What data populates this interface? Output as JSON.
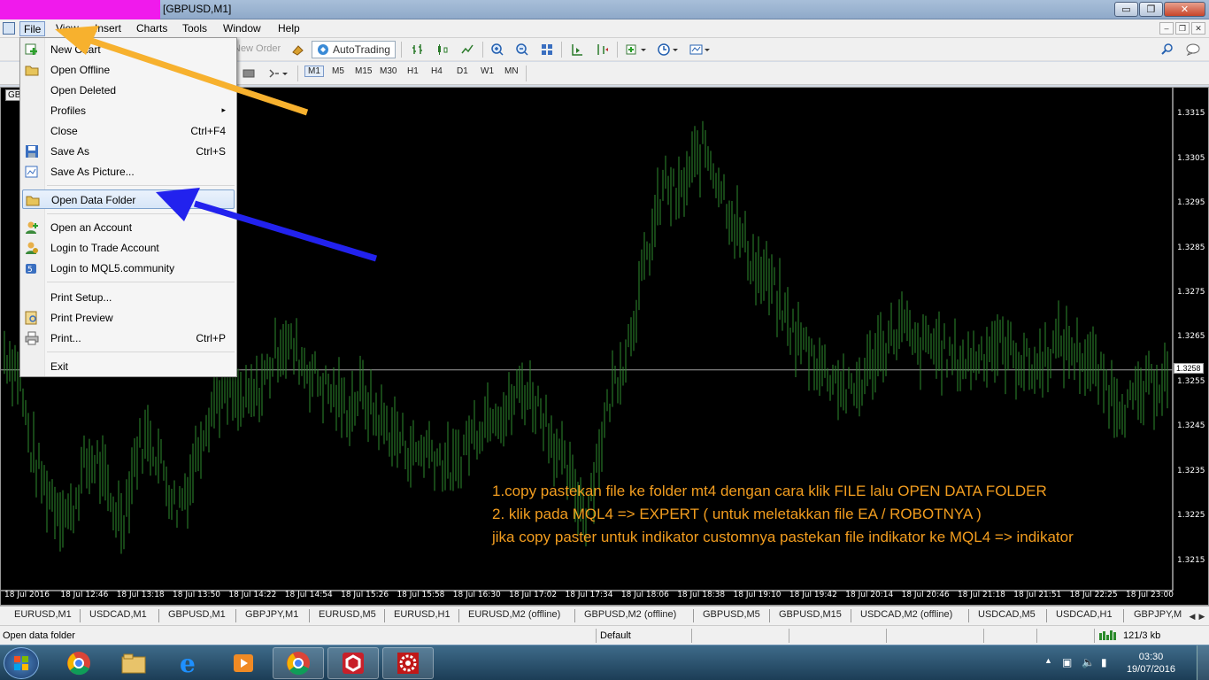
{
  "window": {
    "title": "[GBPUSD,M1]",
    "controls": {
      "minimize": "▭",
      "maximize": "❐",
      "close": "✕"
    }
  },
  "menubar": {
    "items": [
      "File",
      "View",
      "Insert",
      "Charts",
      "Tools",
      "Window",
      "Help"
    ],
    "active": "File",
    "mdi": {
      "min": "–",
      "restore": "❐",
      "close": "✕"
    }
  },
  "toolbar": {
    "new_order": "New Order",
    "autotrading": "AutoTrading",
    "timeframes": [
      "M1",
      "M5",
      "M15",
      "M30",
      "H1",
      "H4",
      "D1",
      "W1",
      "MN"
    ],
    "selected_timeframe": "M1"
  },
  "file_menu": {
    "items": [
      {
        "label": "New Chart",
        "shortcut": "",
        "icon": "new-chart-icon"
      },
      {
        "label": "Open Offline",
        "shortcut": "",
        "icon": "open-folder-icon"
      },
      {
        "label": "Open Deleted",
        "shortcut": "",
        "icon": ""
      },
      {
        "label": "Profiles",
        "shortcut": "▸",
        "icon": ""
      },
      {
        "label": "Close",
        "shortcut": "Ctrl+F4",
        "icon": ""
      },
      {
        "label": "Save As",
        "shortcut": "Ctrl+S",
        "icon": "save-icon"
      },
      {
        "label": "Save As Picture...",
        "shortcut": "",
        "icon": "picture-icon"
      },
      {
        "label": "Open Data Folder",
        "shortcut": "",
        "icon": "folder-icon"
      },
      {
        "label": "Open an Account",
        "shortcut": "",
        "icon": "account-icon"
      },
      {
        "label": "Login to Trade Account",
        "shortcut": "",
        "icon": "login-icon"
      },
      {
        "label": "Login to MQL5.community",
        "shortcut": "",
        "icon": "mql5-icon"
      },
      {
        "label": "Print Setup...",
        "shortcut": "",
        "icon": ""
      },
      {
        "label": "Print Preview",
        "shortcut": "",
        "icon": "print-preview-icon"
      },
      {
        "label": "Print...",
        "shortcut": "Ctrl+P",
        "icon": "printer-icon"
      },
      {
        "label": "Exit",
        "shortcut": "",
        "icon": ""
      }
    ],
    "highlighted": "Open Data Folder"
  },
  "chart": {
    "tab_label": "GBPUSD,M1",
    "current_price": "1.3258",
    "colors": {
      "background": "#000000",
      "candles": "#2e8b2e",
      "price_line": "#a0a0a0"
    },
    "annotations": [
      "1.copy pastekan file ke folder mt4 dengan cara  klik FILE lalu OPEN DATA FOLDER",
      "2. klik pada MQL4 => EXPERT  ( untuk meletakkan file EA / ROBOTNYA )",
      "jika copy paster untuk indikator customnya  pastekan file indikator ke  MQL4 => indikator"
    ],
    "annotation_color": "#f29d1f"
  },
  "chart_data": {
    "type": "bar",
    "symbol": "GBPUSD",
    "timeframe": "M1",
    "y_ticks": [
      "1.3315",
      "1.3305",
      "1.3295",
      "1.3285",
      "1.3275",
      "1.3265",
      "1.3255",
      "1.3245",
      "1.3235",
      "1.3225",
      "1.3215"
    ],
    "x_ticks": [
      "18 Jul 2016",
      "18 Jul 12:46",
      "18 Jul 13:18",
      "18 Jul 13:50",
      "18 Jul 14:22",
      "18 Jul 14:54",
      "18 Jul 15:26",
      "18 Jul 15:58",
      "18 Jul 16:30",
      "18 Jul 17:02",
      "18 Jul 17:34",
      "18 Jul 18:06",
      "18 Jul 18:38",
      "18 Jul 19:10",
      "18 Jul 19:42",
      "18 Jul 20:14",
      "18 Jul 20:46",
      "18 Jul 21:18",
      "18 Jul 21:51",
      "18 Jul 22:25",
      "18 Jul 23:00"
    ],
    "ylim": [
      1.3209,
      1.332
    ],
    "price_line": 1.3258,
    "close_path": [
      1.3262,
      1.3258,
      1.324,
      1.3232,
      1.3228,
      1.3225,
      1.3236,
      1.3238,
      1.3228,
      1.3225,
      1.324,
      1.3243,
      1.3236,
      1.3227,
      1.3233,
      1.3245,
      1.3252,
      1.3253,
      1.325,
      1.3252,
      1.3258,
      1.3265,
      1.3262,
      1.3258,
      1.3255,
      1.3252,
      1.3249,
      1.3253,
      1.3248,
      1.3245,
      1.3242,
      1.3239,
      1.3241,
      1.3238,
      1.3235,
      1.3242,
      1.3246,
      1.325,
      1.3248,
      1.3254,
      1.3252,
      1.3247,
      1.3238,
      1.3232,
      1.3226,
      1.324,
      1.3254,
      1.3262,
      1.3275,
      1.3288,
      1.33,
      1.3296,
      1.3303,
      1.3308,
      1.3301,
      1.3293,
      1.3286,
      1.328,
      1.3277,
      1.327,
      1.3265,
      1.3262,
      1.3258,
      1.3256,
      1.3252,
      1.3256,
      1.3262,
      1.3265,
      1.3268,
      1.3262,
      1.3264,
      1.3262,
      1.326,
      1.326,
      1.3262,
      1.3264,
      1.3262,
      1.326,
      1.3258,
      1.3262,
      1.3264,
      1.3262,
      1.326,
      1.3256,
      1.3252,
      1.325,
      1.3252,
      1.3255,
      1.3257
    ]
  },
  "chart_tabs": [
    "EURUSD,M1",
    "USDCAD,M1",
    "GBPUSD,M1",
    "GBPJPY,M1",
    "EURUSD,M5",
    "EURUSD,H1",
    "EURUSD,M2 (offline)",
    "GBPUSD,M2 (offline)",
    "GBPUSD,M5",
    "GBPUSD,M15",
    "USDCAD,M2 (offline)",
    "USDCAD,M5",
    "USDCAD,H1",
    "GBPJPY,M"
  ],
  "statusbar": {
    "left": "Open data folder",
    "profile": "Default",
    "traffic": "121/3 kb"
  },
  "taskbar": {
    "time": "03:30",
    "date": "19/07/2016"
  }
}
